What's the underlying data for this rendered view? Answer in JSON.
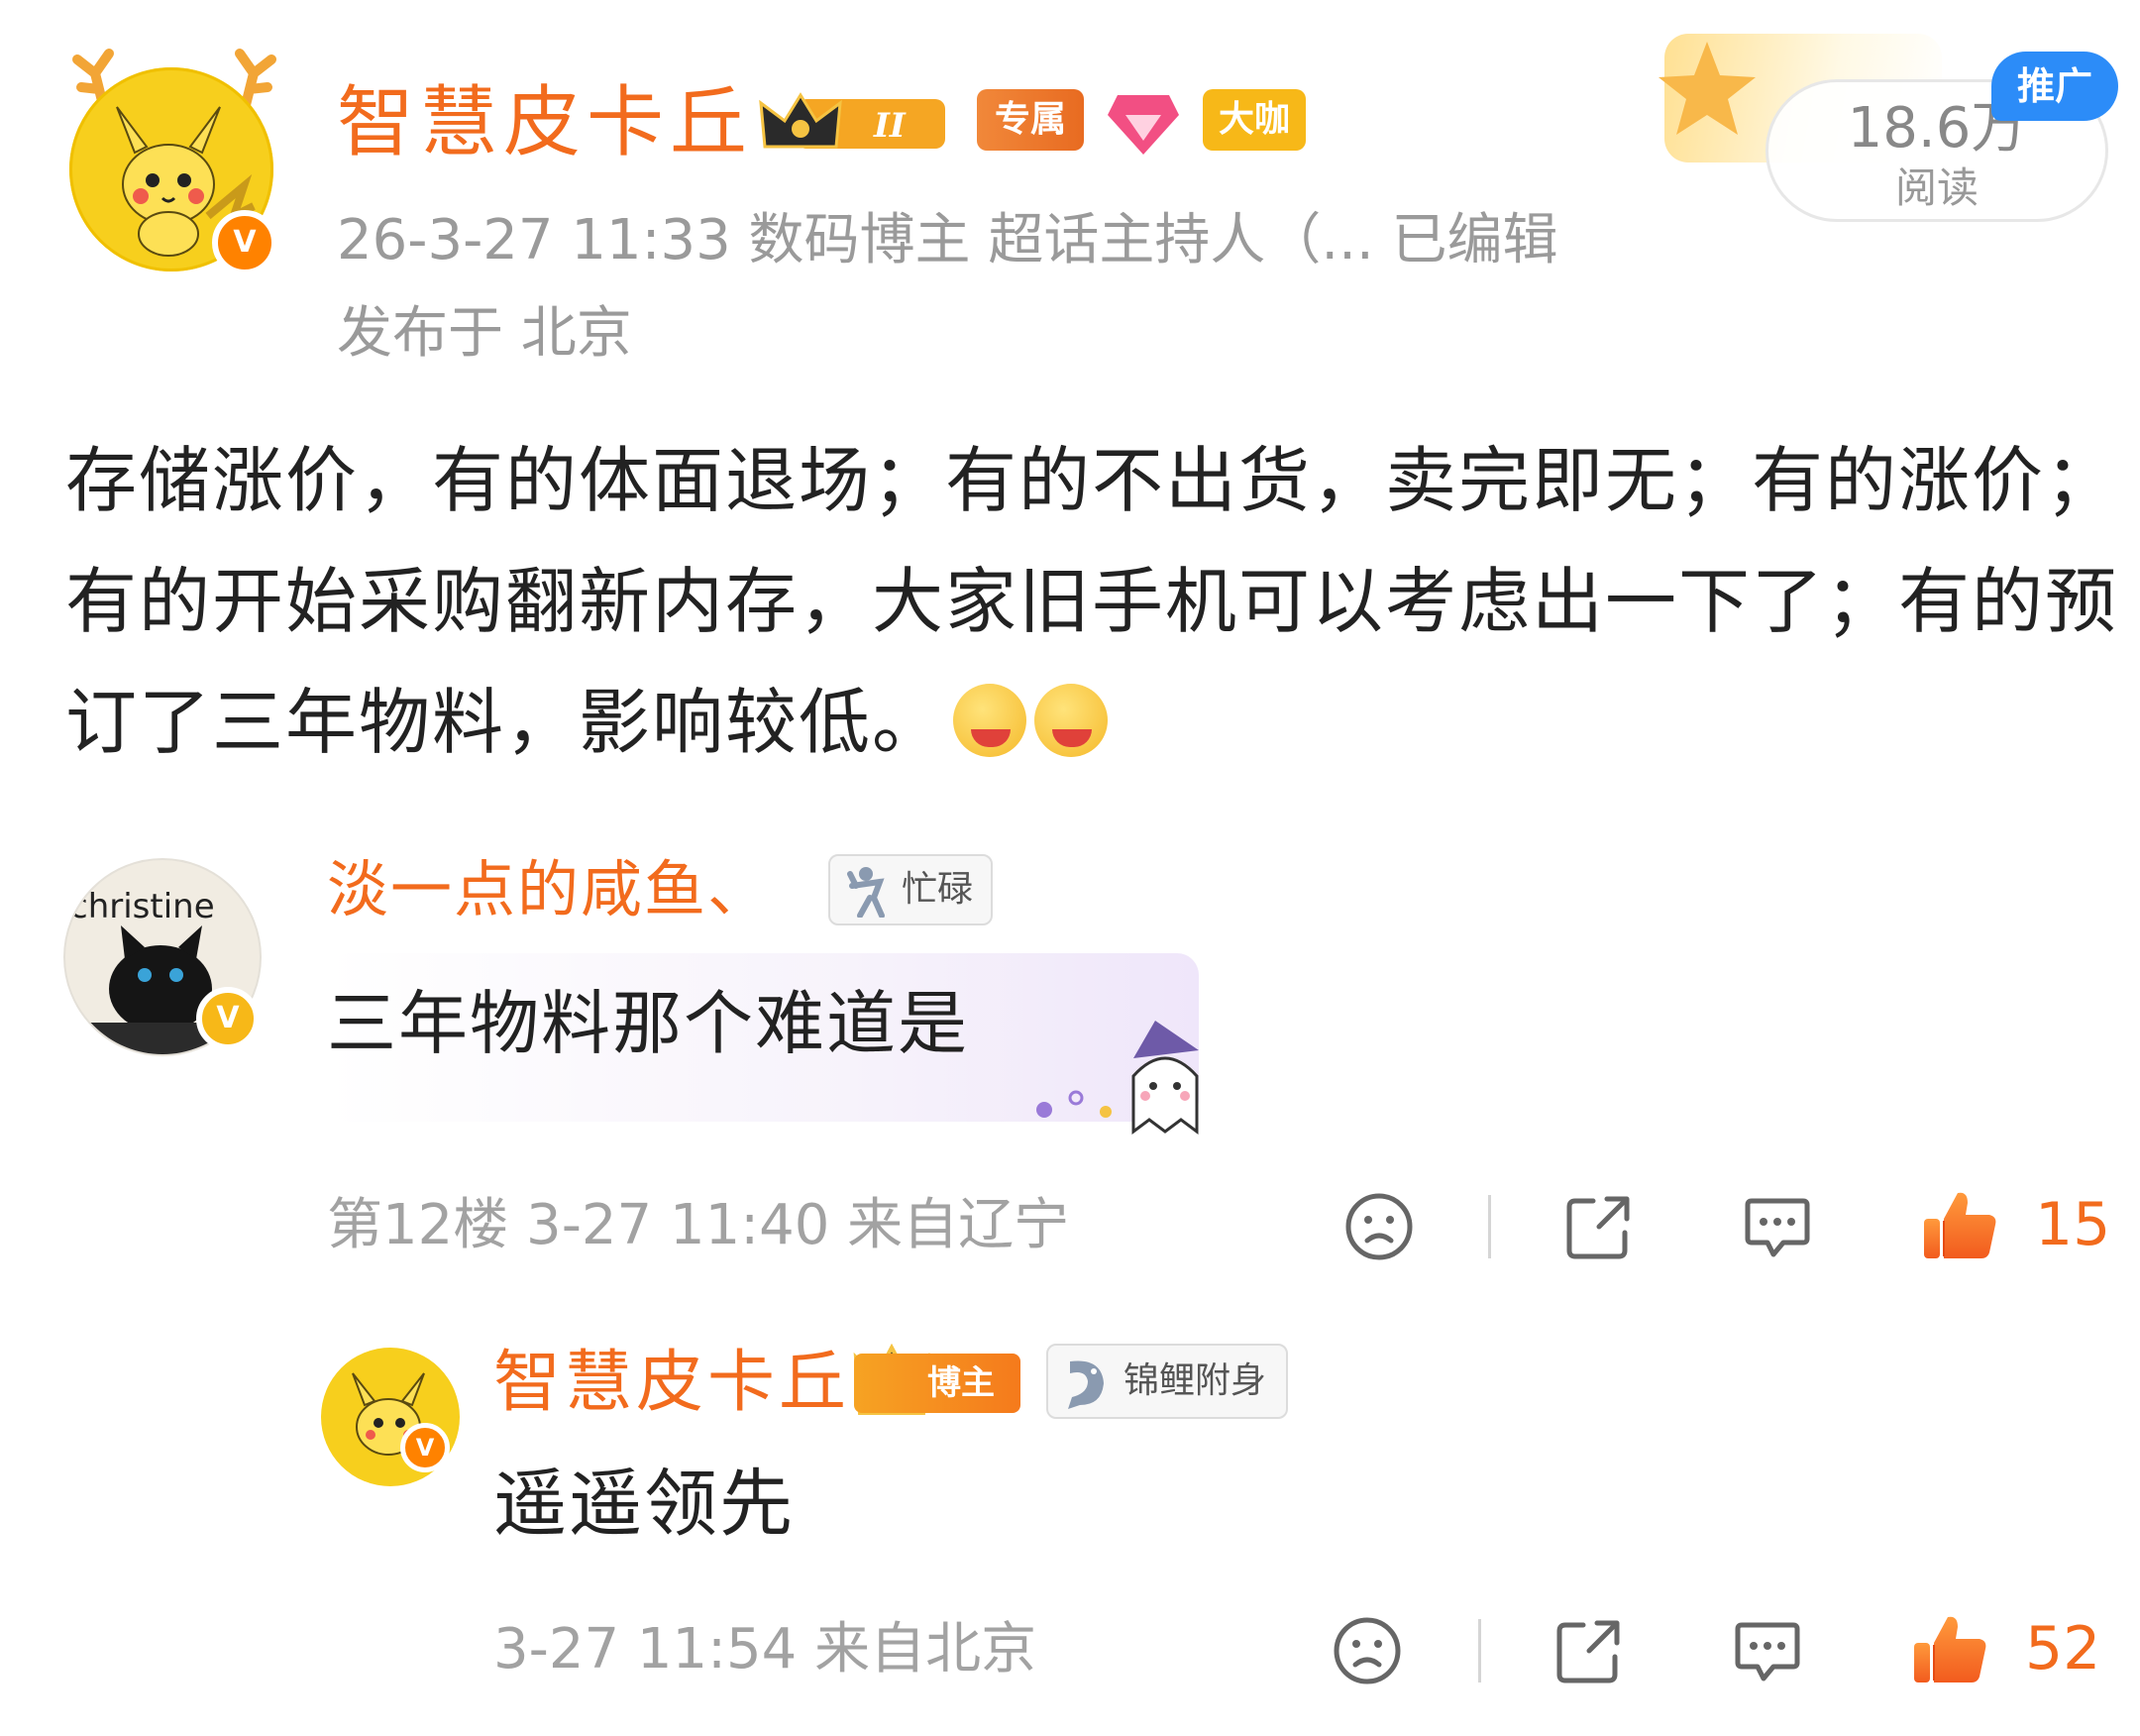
{
  "post": {
    "author": "智慧皮卡丘",
    "badges": {
      "level": "II",
      "exclusive": "专属",
      "big_shot": "大咖"
    },
    "meta_line1": "26-3-27 11:33   数码博主 超话主持人（...   已编辑",
    "meta_line2": "发布于 北京",
    "read_count": "18.6万",
    "read_label": "阅读",
    "promo_label": "推广",
    "body": "存储涨价，有的体面退场；有的不出货，卖完即无；有的涨价；有的开始采购翻新内存，大家旧手机可以考虑出一下了；有的预订了三年物料，影响较低。",
    "body_emojis": [
      "watermelon-emoji",
      "watermelon-emoji"
    ]
  },
  "comment": {
    "author": "淡一点的咸鱼、",
    "status_badge": "忙碌",
    "avatar_text": "christine",
    "text": "三年物料那个难道是",
    "footer": "第12楼  3-27 11:40   来自辽宁",
    "likes": "15"
  },
  "reply": {
    "author": "智慧皮卡丘",
    "role_badge": "博主",
    "lucky_badge": "锦鲤附身",
    "text": "遥遥领先",
    "footer": "3-27 11:54   来自北京",
    "likes": "52"
  },
  "colors": {
    "accent": "#f26b1d",
    "meta_gray": "#9a9a9a",
    "verify": "#ff8200",
    "promo": "#2c8cf8"
  },
  "icons": {
    "dislike": "frown-face-icon",
    "share": "share-icon",
    "comment": "comment-bubble-icon",
    "like": "thumbs-up-icon"
  }
}
